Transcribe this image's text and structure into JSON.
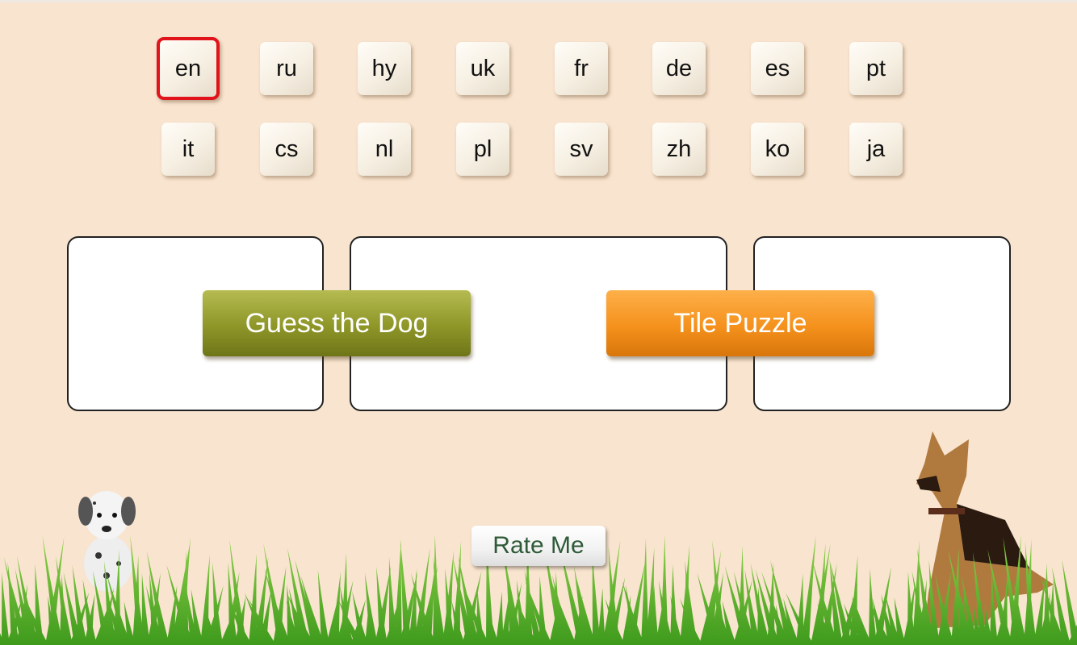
{
  "languages": {
    "row1": [
      "en",
      "ru",
      "hy",
      "uk",
      "fr",
      "de",
      "es",
      "pt"
    ],
    "row2": [
      "it",
      "cs",
      "nl",
      "pl",
      "sv",
      "zh",
      "ko",
      "ja"
    ],
    "selected": "en",
    "selected_color": "#e0141a"
  },
  "games": {
    "guess": {
      "label": "Guess the Dog",
      "color": "#8e9628"
    },
    "tile": {
      "label": "Tile Puzzle",
      "color": "#f5911c"
    }
  },
  "rate": {
    "label": "Rate Me"
  }
}
